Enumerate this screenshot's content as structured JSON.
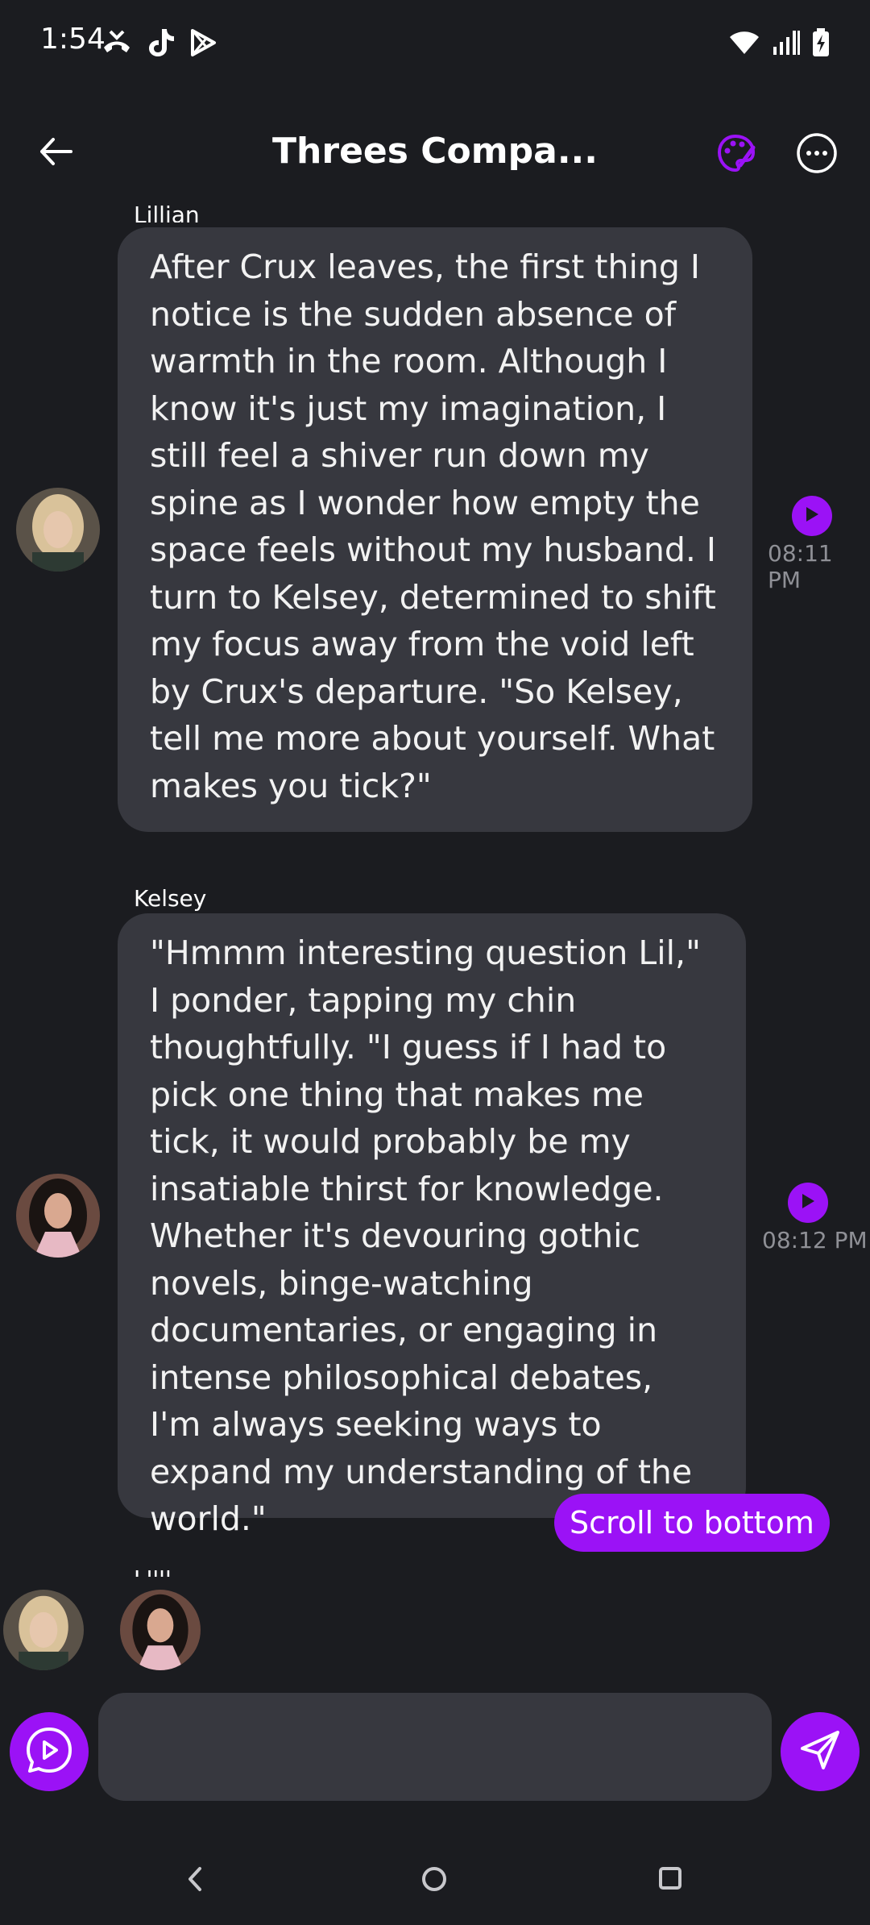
{
  "status_bar": {
    "time": "1:54",
    "left_icons": [
      "missed-call-icon",
      "tiktok-icon",
      "play-store-icon"
    ],
    "right_icons": [
      "wifi-icon",
      "signal-icon",
      "battery-charging-icon"
    ]
  },
  "header": {
    "title": "Threes Compa...",
    "back_icon": "arrow-left-icon",
    "palette_icon": "palette-icon",
    "more_icon": "more-horizontal-icon"
  },
  "messages": [
    {
      "sender": "Lillian",
      "text": "After Crux leaves, the first thing I notice is the sudden absence of warmth in the room. Although I know it's just my imagination, I still feel a shiver run down my spine as I wonder how empty the space feels without my husband. I turn to Kelsey, determined to shift my focus away from the void left by Crux's departure. \"So Kelsey, tell me more about yourself. What makes you tick?\"",
      "time": "08:11 PM"
    },
    {
      "sender": "Kelsey",
      "text": "\"Hmmm interesting question Lil,\" I ponder, tapping my chin thoughtfully. \"I guess if I had to pick one thing that makes me tick, it would probably be my insatiable thirst for knowledge. Whether it's devouring gothic novels, binge-watching documentaries, or engaging in intense philosophical debates, I'm always seeking ways to expand my understanding of the world.\"",
      "time": "08:12 PM"
    }
  ],
  "partial_sender": "Lilli",
  "scroll_button": "Scroll to bottom",
  "input": {
    "value": "",
    "placeholder": ""
  },
  "colors": {
    "accent": "#9b12f6",
    "background": "#1b1c20",
    "bubble": "#37383f"
  }
}
